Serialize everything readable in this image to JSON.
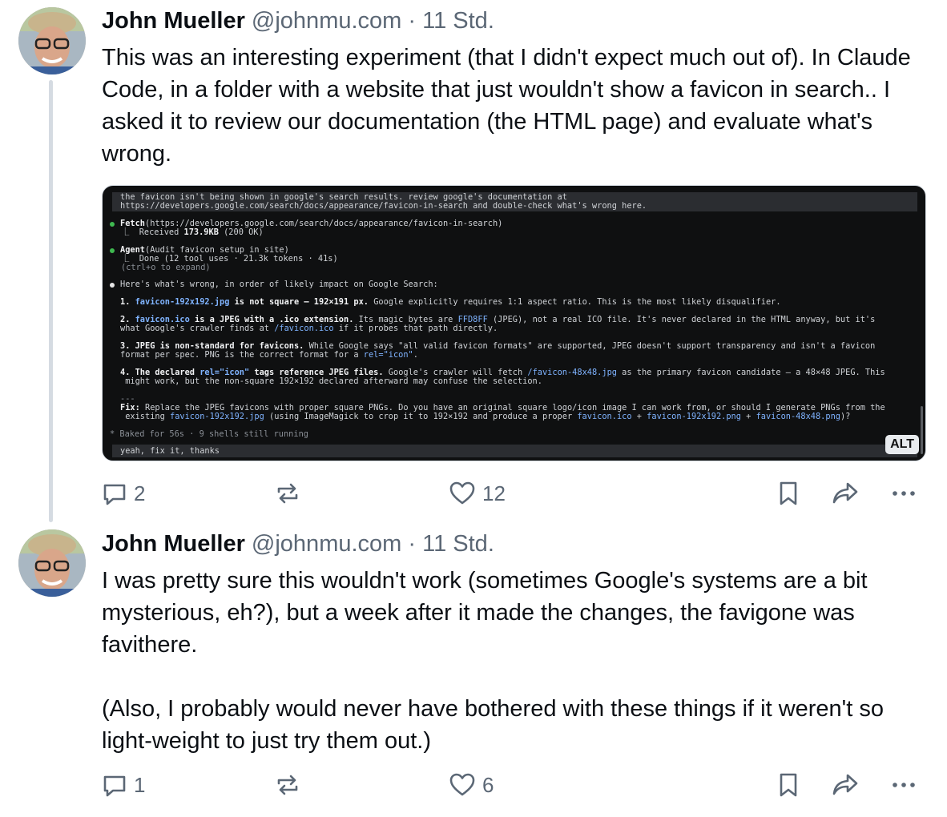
{
  "posts": [
    {
      "author": "John Mueller",
      "handle": "@johnmu.com",
      "separator": "·",
      "time": "11 Std.",
      "text": "This was an interesting experiment (that I didn't expect much out of). In Claude Code, in a folder with a website that just wouldn't show a favicon in search.. I asked it to review our documentation (the HTML page) and evaluate what's wrong.",
      "replies": "2",
      "likes": "12"
    },
    {
      "author": "John Mueller",
      "handle": "@johnmu.com",
      "separator": "·",
      "time": "11 Std.",
      "text": "I was pretty sure this wouldn't work (sometimes Google's systems are a bit mysterious, eh?), but a week after it made the changes, the favigone was favithere.\n\n(Also, I probably would never have bothered with these things if it weren't so light-weight to just try them out.)",
      "replies": "1",
      "likes": "6"
    }
  ],
  "terminal": {
    "prompt1_a": "the favicon isn't being shown in google's search results. review google's documentation at",
    "prompt1_b": "https://developers.google.com/search/docs/appearance/favicon-in-search and double-check what's wrong here.",
    "fetch_a": "Fetch",
    "fetch_b": "(https://developers.google.com/search/docs/appearance/favicon-in-search)",
    "fetch_r1": "⎿  Received ",
    "fetch_r2": "173.9KB",
    "fetch_r3": " (200 OK)",
    "agent_a": "Agent",
    "agent_b": "(Audit favicon setup in site)",
    "agent_r": "⎿  Done (12 tool uses · 21.3k tokens · 41s)",
    "agent_expand": "(ctrl+o to expand)",
    "summary": "Here's what's wrong, in order of likely impact on Google Search:",
    "i1_n": "1. ",
    "i1_f": "favicon-192x192.jpg",
    "i1_b": " is not square — 192×191 px.",
    "i1_t": " Google explicitly requires 1:1 aspect ratio. This is the most likely disqualifier.",
    "i2_n": "2. ",
    "i2_f": "favicon.ico",
    "i2_b": " is a JPEG with a .ico extension.",
    "i2_t1": " Its magic bytes are ",
    "i2_h": "FFD8FF",
    "i2_t2": " (JPEG), not a real ICO file. It's never declared in the HTML anyway, but it's",
    "i2_l2a": "what Google's crawler finds at ",
    "i2_l2h": "/favicon.ico",
    "i2_l2b": " if it probes that path directly.",
    "i3_b": "3. JPEG is non-standard for favicons.",
    "i3_t": " While Google says \"all valid favicon formats\" are supported, JPEG doesn't support transparency and isn't a favicon",
    "i3_l2a": "format per spec. PNG is the correct format for a ",
    "i3_l2h": "rel=\"icon\"",
    "i3_l2b": ".",
    "i4_b1": "4. The declared ",
    "i4_h": "rel=\"icon\"",
    "i4_b2": " tags reference JPEG files.",
    "i4_t1": " Google's crawler will fetch ",
    "i4_h2": "/favicon-48x48.jpg",
    "i4_t2": " as the primary favicon candidate — a 48×48 JPEG. This",
    "i4_l2": " might work, but the non-square 192×192 declared afterward may confuse the selection.",
    "rule": "---",
    "fix_b": "Fix:",
    "fix_t": " Replace the JPEG favicons with proper square PNGs. Do you have an original square logo/icon image I can work from, or should I generate PNGs from the",
    "fix_l2a": " existing ",
    "fix_h1": "favicon-192x192.jpg",
    "fix_l2b": " (using ImageMagick to crop it to 192×192 and produce a proper ",
    "fix_h2": "favicon.ico",
    "fix_l2c": " + ",
    "fix_h3": "favicon-192x192.png",
    "fix_l2d": " + ",
    "fix_h4": "favicon-48x48.png",
    "fix_l2e": ")?",
    "baked": "* Baked for 56s · 9 shells still running",
    "prompt2": "yeah, fix it, thanks",
    "alt": "ALT"
  },
  "colors": {
    "accent": "#5b6775",
    "dot_green": "#3fb950",
    "dot_white": "#e6e6e6",
    "link": "#7fb3ff"
  }
}
